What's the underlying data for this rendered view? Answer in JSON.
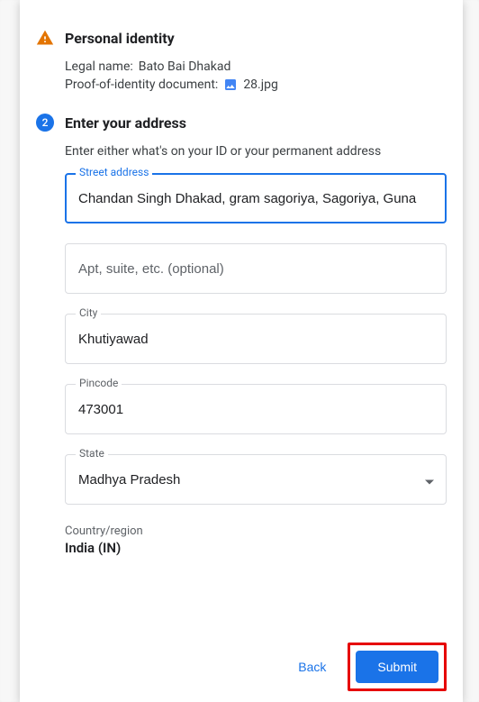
{
  "section1": {
    "title": "Personal identity",
    "legal_name_label": "Legal name:",
    "legal_name_value": "Bato Bai Dhakad",
    "proof_label": "Proof-of-identity document:",
    "proof_file": "28.jpg"
  },
  "section2": {
    "step_number": "2",
    "title": "Enter your address",
    "hint": "Enter either what's on your ID or your permanent address",
    "street_label": "Street address",
    "street_value": "Chandan Singh Dhakad, gram sagoriya, Sagoriya, Guna",
    "apt_placeholder": "Apt, suite, etc. (optional)",
    "apt_value": "",
    "city_label": "City",
    "city_value": "Khutiyawad",
    "pincode_label": "Pincode",
    "pincode_value": "473001",
    "state_label": "State",
    "state_value": "Madhya Pradesh",
    "country_label": "Country/region",
    "country_value": "India (IN)"
  },
  "footer": {
    "back_label": "Back",
    "submit_label": "Submit"
  }
}
